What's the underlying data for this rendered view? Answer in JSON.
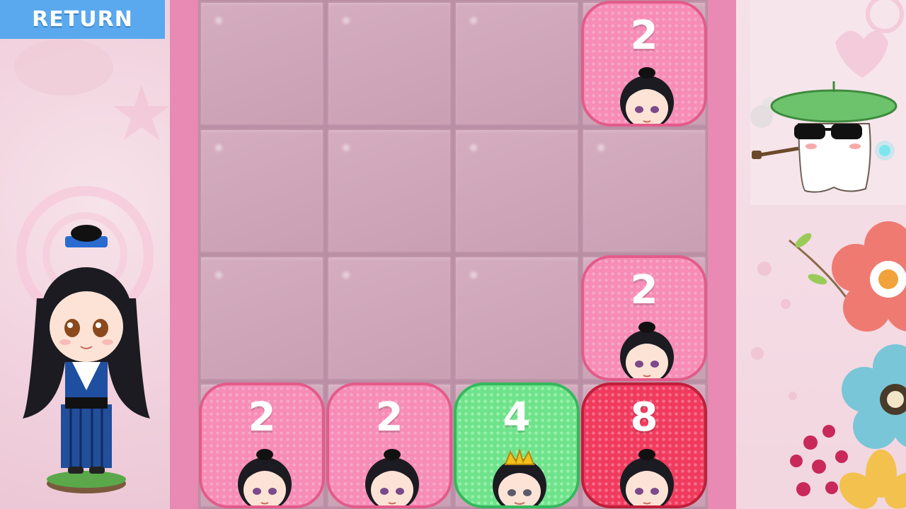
{
  "header": {
    "return_label": "RETURN"
  },
  "colors": {
    "tile_2": "#f78cb6",
    "tile_4": "#6fe38b",
    "tile_8": "#f03b5e",
    "board_frame": "#e88ab3",
    "empty_cell": "#d0a6ba",
    "return_button": "#5aa9ee"
  },
  "board": {
    "rows": 4,
    "cols": 4,
    "grid": [
      [
        0,
        0,
        0,
        2
      ],
      [
        0,
        0,
        0,
        0
      ],
      [
        0,
        0,
        0,
        2
      ],
      [
        2,
        2,
        4,
        8
      ]
    ]
  },
  "tiles": [
    {
      "value": "2"
    },
    {
      "value": "2"
    },
    {
      "value": "2"
    },
    {
      "value": "2"
    },
    {
      "value": "4"
    },
    {
      "value": "8"
    }
  ],
  "decorations": {
    "left_character": "chibi-girl-character",
    "right_character": "ghost-with-leaf-hat-icon",
    "flowers": "flower-decoration"
  }
}
